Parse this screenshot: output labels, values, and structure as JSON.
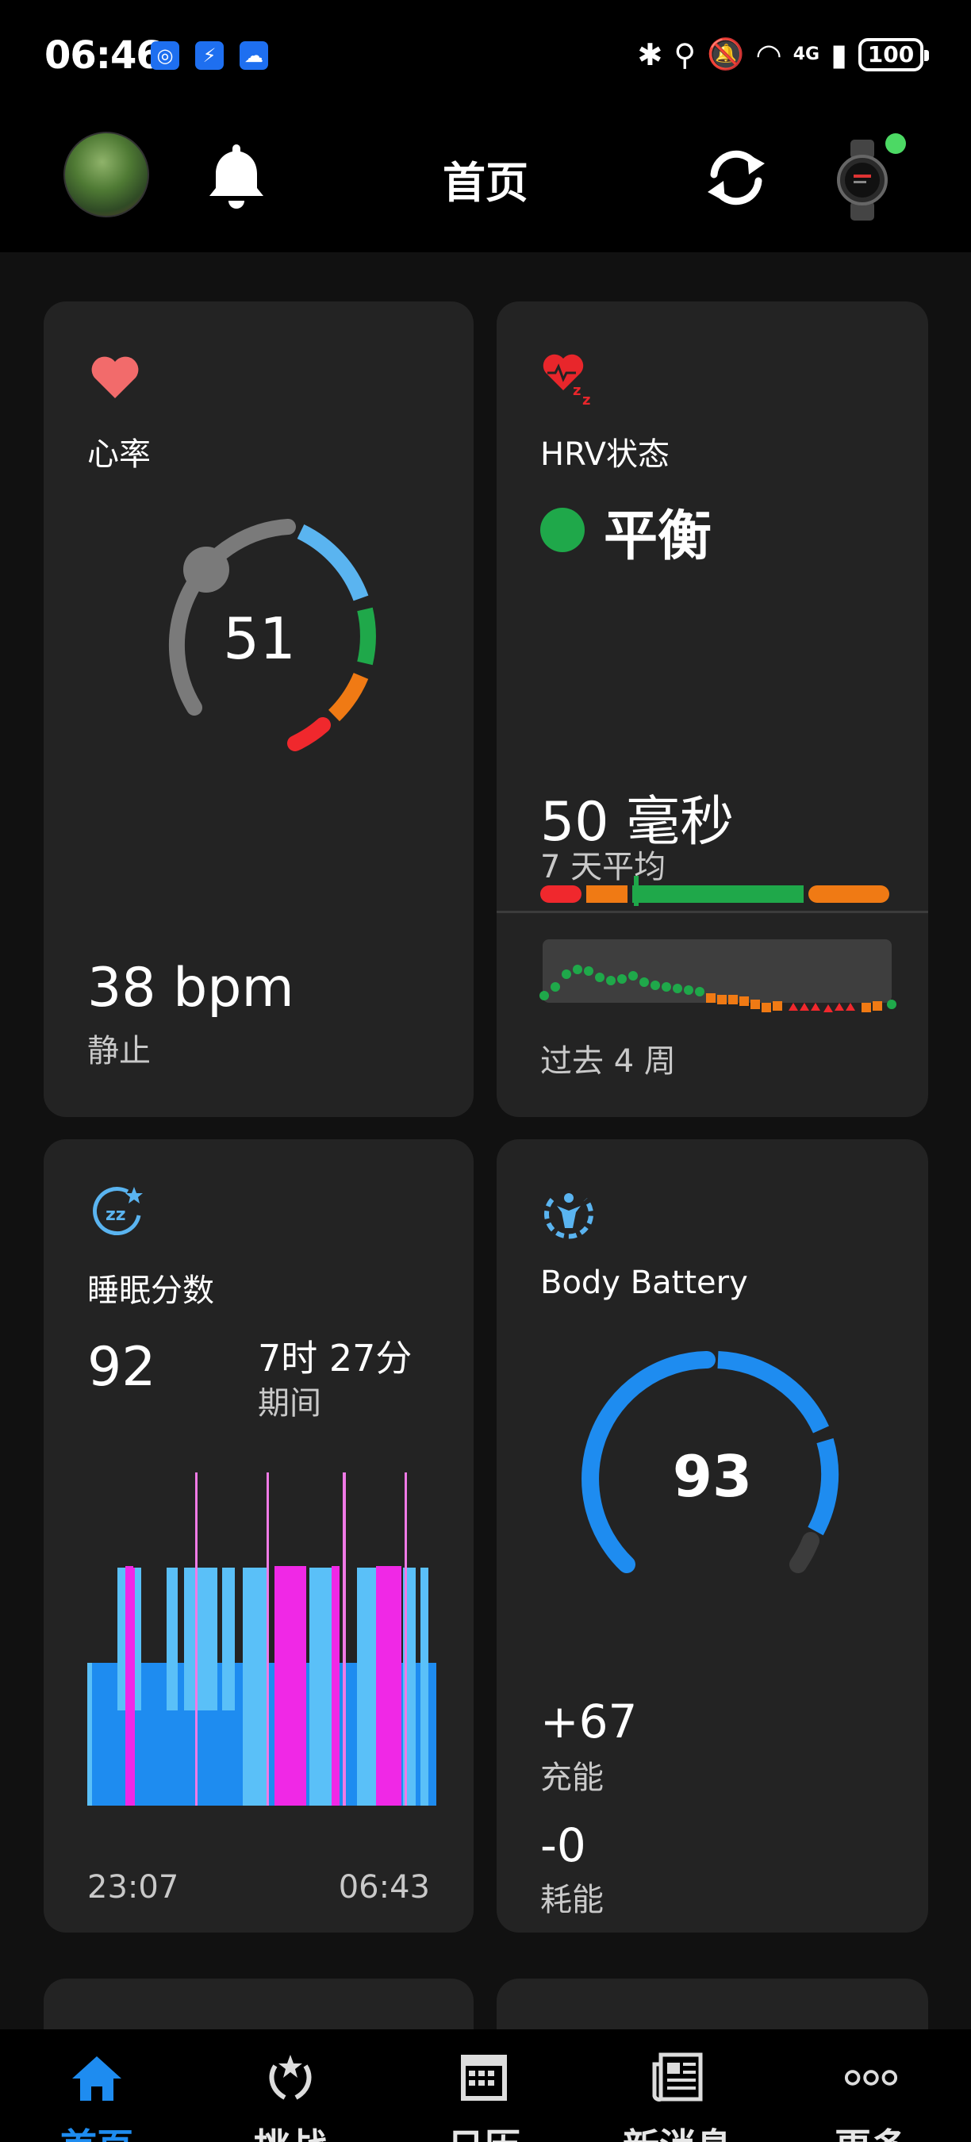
{
  "status_bar": {
    "time": "06:46",
    "network": "4G",
    "battery": "100"
  },
  "header": {
    "title": "首页"
  },
  "heart_rate_card": {
    "title": "心率",
    "current_value": "51",
    "resting_value": "38 bpm",
    "resting_label": "静止",
    "colors": {
      "gray": "#7a7a7a",
      "blue": "#5ab4f0",
      "green": "#1fa84a",
      "orange": "#f07a14",
      "red": "#f0282d"
    }
  },
  "hrv_card": {
    "title": "HRV状态",
    "status": "平衡",
    "status_color": "#1fa84a",
    "value": "50 毫秒",
    "value_sub": "7 天平均",
    "period_label": "过去 4 周"
  },
  "sleep_card": {
    "title": "睡眠分数",
    "score": "92",
    "duration": "7时 27分",
    "duration_label": "期间",
    "start_time": "23:07",
    "end_time": "06:43",
    "colors": {
      "deep": "#1e8cf0",
      "light": "#5ac0f8",
      "rem": "#f028e6",
      "awake": "#f07ae6"
    }
  },
  "body_battery_card": {
    "title": "Body Battery",
    "level": "93",
    "level_value": 93,
    "charged": "+67",
    "charged_label": "充能",
    "drained": "-0",
    "drained_label": "耗能",
    "color": "#1e8cf0"
  },
  "bottom_nav": {
    "items": [
      {
        "label": "首页",
        "icon": "home-icon"
      },
      {
        "label": "挑战",
        "icon": "laurel-icon"
      },
      {
        "label": "日历",
        "icon": "calendar-icon"
      },
      {
        "label": "新消息",
        "icon": "news-icon"
      },
      {
        "label": "更多",
        "icon": "more-icon"
      }
    ]
  }
}
